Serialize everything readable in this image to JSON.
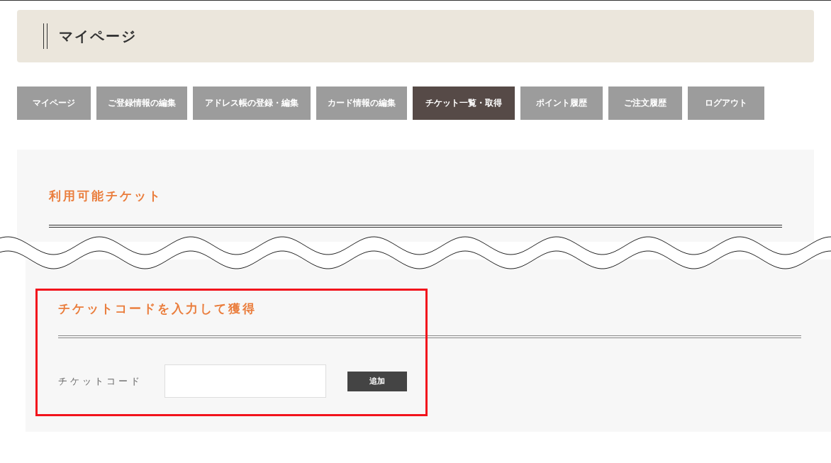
{
  "page_title": "マイページ",
  "nav": [
    {
      "label": "マイページ",
      "selected": false
    },
    {
      "label": "ご登録情報の編集",
      "selected": false
    },
    {
      "label": "アドレス帳の登録・編集",
      "selected": false
    },
    {
      "label": "カード情報の編集",
      "selected": false
    },
    {
      "label": "チケット一覧・取得",
      "selected": true
    },
    {
      "label": "ポイント履歴",
      "selected": false
    },
    {
      "label": "ご注文履歴",
      "selected": false
    },
    {
      "label": "ログアウト",
      "selected": false
    }
  ],
  "available_tickets": {
    "title": "利用可能チケット"
  },
  "ticket_code_form": {
    "title": "チケットコードを入力して獲得",
    "field_label": "チケットコード",
    "button": "追加"
  }
}
